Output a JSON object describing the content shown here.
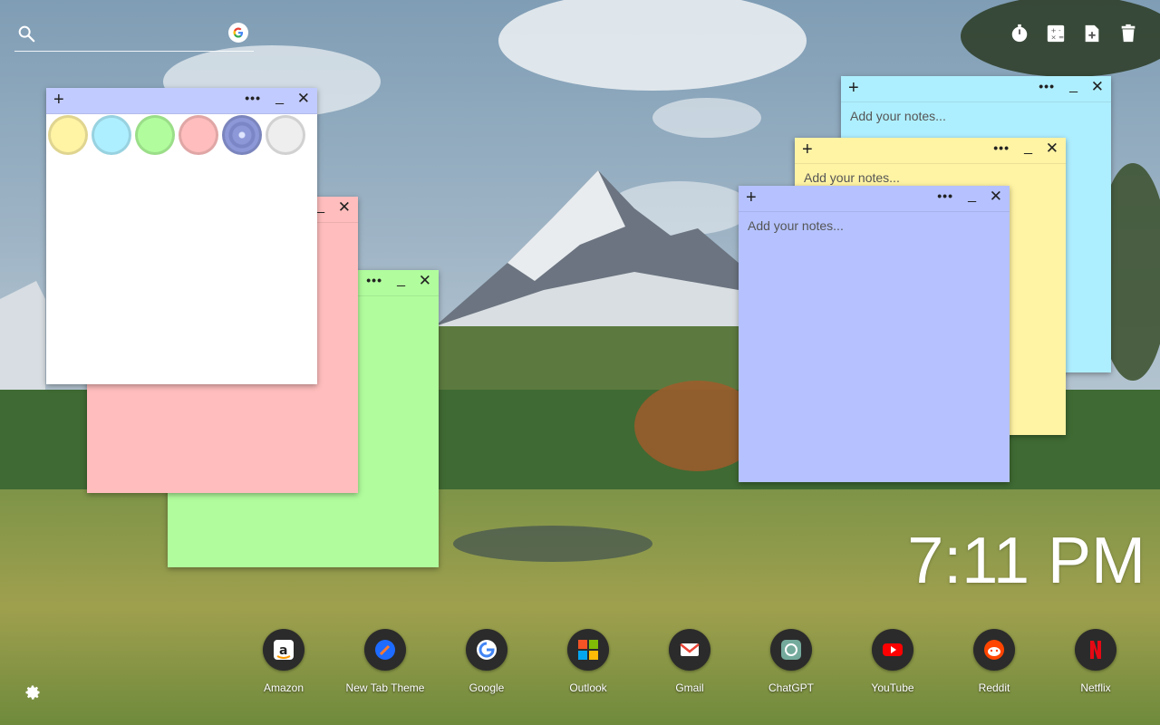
{
  "search": {
    "placeholder": "",
    "value": ""
  },
  "toolbar": {
    "icons": [
      "timer-icon",
      "calculator-icon",
      "new-note-icon",
      "trash-icon"
    ]
  },
  "notes": [
    {
      "id": "blue",
      "color": "#aeefff",
      "placeholder": "Add your notes..."
    },
    {
      "id": "yellow",
      "color": "#fff3a4",
      "placeholder": "Add your notes..."
    },
    {
      "id": "periwinkle",
      "color": "#b5c2ff",
      "placeholder": "Add your notes..."
    },
    {
      "id": "green",
      "color": "#b1fd9d",
      "placeholder": ""
    },
    {
      "id": "pink",
      "color": "#ffbdbd",
      "placeholder": ""
    },
    {
      "id": "white",
      "color": "#ffffff",
      "header_color": "#c2cbff",
      "placeholder": ""
    }
  ],
  "color_swatches": [
    "#fff3a4",
    "#aeefff",
    "#b1fd9d",
    "#ffbdbd",
    "#8c98d8",
    "#eeeeee"
  ],
  "note_controls": {
    "add": "+",
    "more": "•••",
    "minimize": "_",
    "close": "✕"
  },
  "clock": {
    "time": "7:11 PM"
  },
  "shortcuts": [
    {
      "label": "Amazon",
      "icon": "amazon-icon",
      "color": "#ff9900"
    },
    {
      "label": "New Tab Theme",
      "icon": "new-tab-theme-icon",
      "color": "#1e6bff"
    },
    {
      "label": "Google",
      "icon": "google-icon",
      "color": "#4285f4"
    },
    {
      "label": "Outlook",
      "icon": "outlook-icon",
      "color": "#0078d4"
    },
    {
      "label": "Gmail",
      "icon": "gmail-icon",
      "color": "#ea4335"
    },
    {
      "label": "ChatGPT",
      "icon": "chatgpt-icon",
      "color": "#74aa9c"
    },
    {
      "label": "YouTube",
      "icon": "youtube-icon",
      "color": "#ff0000"
    },
    {
      "label": "Reddit",
      "icon": "reddit-icon",
      "color": "#ff4500"
    },
    {
      "label": "Netflix",
      "icon": "netflix-icon",
      "color": "#e50914"
    }
  ]
}
